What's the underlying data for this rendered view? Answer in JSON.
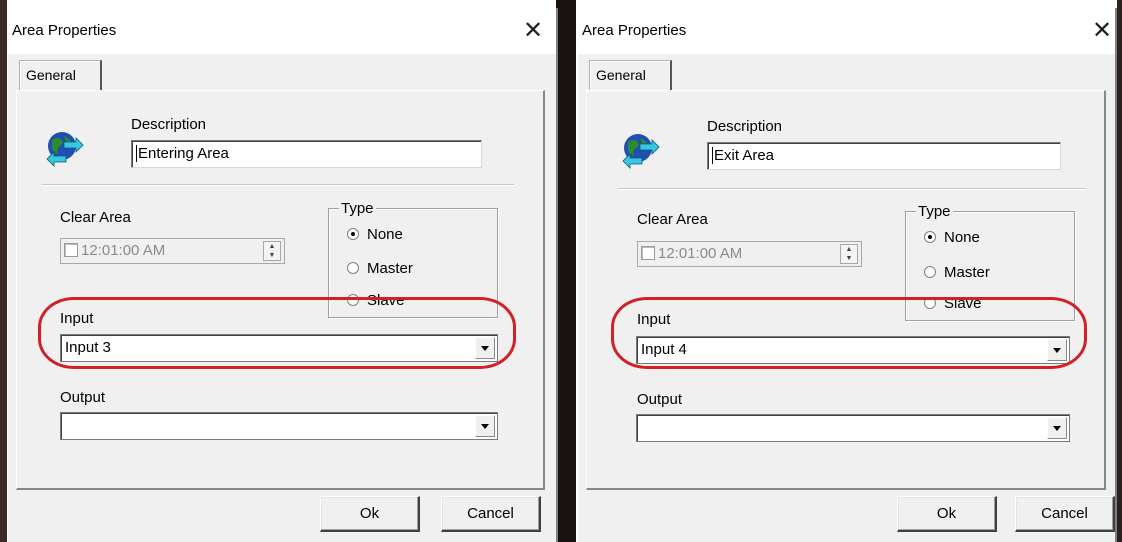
{
  "dialogs": [
    {
      "title": "Area Properties",
      "tab": "General",
      "description_label": "Description",
      "description_value": "Entering Area",
      "clear_area_label": "Clear Area",
      "clear_area_time": "12:01:00 AM",
      "type_label": "Type",
      "type_options": [
        "None",
        "Master",
        "Slave"
      ],
      "type_selected": "None",
      "input_label": "Input",
      "input_value": "Input 3",
      "output_label": "Output",
      "output_value": "",
      "ok_label": "Ok",
      "cancel_label": "Cancel"
    },
    {
      "title": "Area Properties",
      "tab": "General",
      "description_label": "Description",
      "description_value": "Exit Area",
      "clear_area_label": "Clear Area",
      "clear_area_time": "12:01:00 AM",
      "type_label": "Type",
      "type_options": [
        "None",
        "Master",
        "Slave"
      ],
      "type_selected": "None",
      "input_label": "Input",
      "input_value": "Input 4",
      "output_label": "Output",
      "output_value": "",
      "ok_label": "Ok",
      "cancel_label": "Cancel"
    }
  ],
  "icons": {
    "close": "close-icon",
    "area": "globe-arrows-icon"
  },
  "colors": {
    "highlight": "#d12028",
    "dialog_bg": "#f0f0f0",
    "globe_blue": "#1f4fb0",
    "globe_green": "#2d8a2d",
    "arrow_cyan": "#38c7e0"
  }
}
